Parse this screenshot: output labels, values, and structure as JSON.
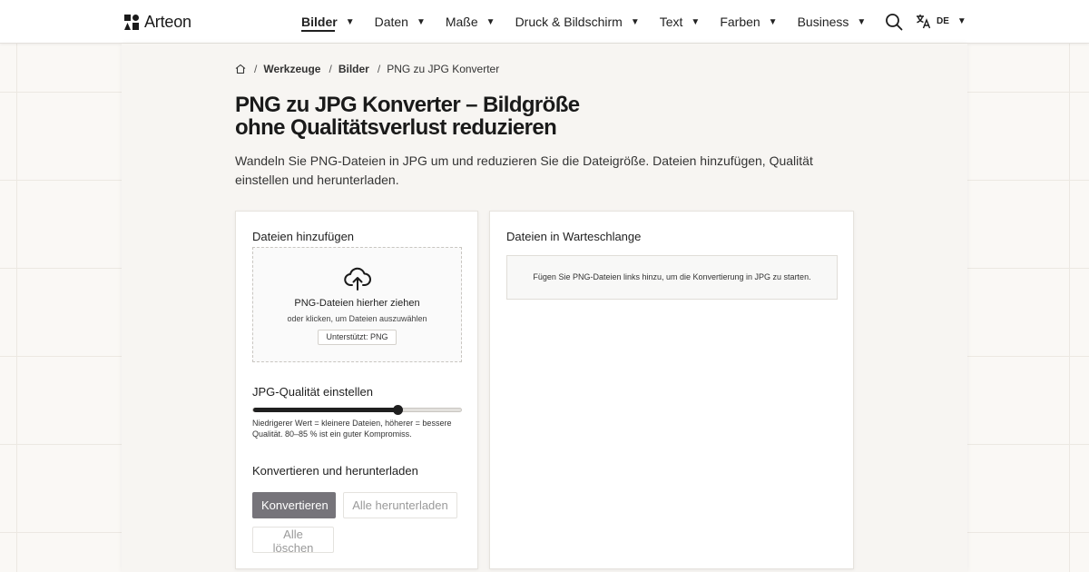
{
  "brand": {
    "name": "Arteon"
  },
  "nav": {
    "items": [
      {
        "label": "Bilder",
        "active": true
      },
      {
        "label": "Daten",
        "active": false
      },
      {
        "label": "Maße",
        "active": false
      },
      {
        "label": "Druck & Bildschirm",
        "active": false
      },
      {
        "label": "Text",
        "active": false
      },
      {
        "label": "Farben",
        "active": false
      },
      {
        "label": "Business",
        "active": false
      }
    ],
    "caret": "▼"
  },
  "header": {
    "language_code": "DE",
    "search_icon": "search-icon",
    "language_icon": "translate-icon"
  },
  "breadcrumb": {
    "home_icon": "home-icon",
    "separator": "/",
    "items": [
      "Werkzeuge",
      "Bilder"
    ],
    "current": "PNG zu JPG Konverter"
  },
  "page": {
    "title_line1": "PNG zu JPG Konverter – Bildgröße",
    "title_line2": "ohne Qualitätsverlust reduzieren",
    "intro": "Wandeln Sie PNG-Dateien in JPG um und reduzieren Sie die Dateigröße. Dateien hinzufügen, Qualität einstellen und herunterladen."
  },
  "upload": {
    "heading": "Dateien hinzufügen",
    "icon": "cloud-upload-icon",
    "drop_text": "PNG-Dateien hierher ziehen",
    "click_text": "oder klicken, um Dateien auszuwählen",
    "supported": "Unterstützt: PNG"
  },
  "quality": {
    "heading": "JPG-Qualität einstellen",
    "value_fraction": 0.7,
    "hint": "Niedrigerer Wert = kleinere Dateien, höherer = bessere Qualität. 80–85 % ist ein guter Kompromiss."
  },
  "actions": {
    "heading": "Konvertieren und herunterladen",
    "convert": "Konvertieren",
    "download_all": "Alle herunterladen",
    "clear_all": "Alle löschen"
  },
  "queue": {
    "heading": "Dateien in Warteschlange",
    "empty_text": "Fügen Sie PNG-Dateien links hinzu, um die Konvertierung in JPG zu starten."
  },
  "colors": {
    "accent": "#1f1f1f",
    "primary_button": "#76747a",
    "page_background": "#faf8f5",
    "card_background": "#ffffff"
  }
}
